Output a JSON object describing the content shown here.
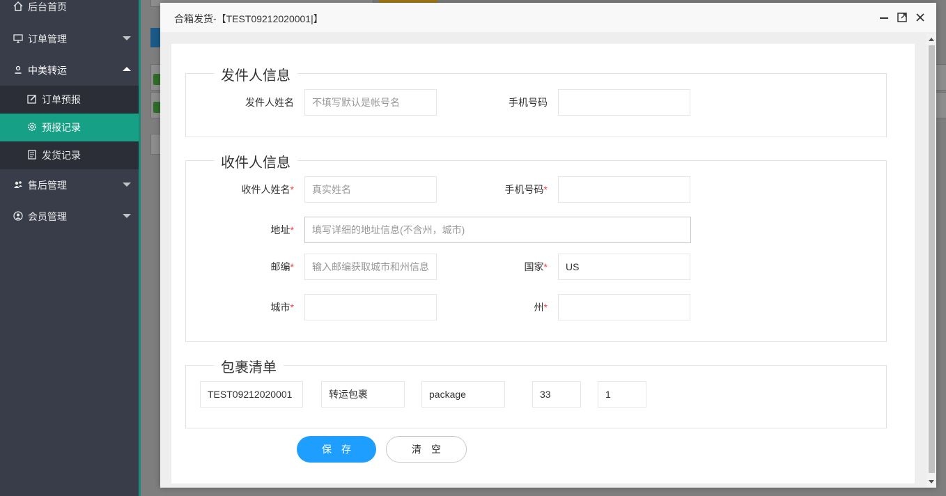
{
  "sidebar": {
    "items": [
      {
        "label": "后台首页",
        "icon": "home-icon"
      },
      {
        "label": "订单管理",
        "icon": "monitor-icon"
      },
      {
        "label": "中美转运",
        "icon": "user-icon"
      },
      {
        "label": "订单预报",
        "icon": "edit-icon"
      },
      {
        "label": "预报记录",
        "icon": "gear-icon"
      },
      {
        "label": "发货记录",
        "icon": "document-icon"
      },
      {
        "label": "售后管理",
        "icon": "group-icon"
      },
      {
        "label": "会员管理",
        "icon": "member-icon"
      }
    ],
    "active_color": "#16a086"
  },
  "modal": {
    "title": "合箱发货-【TEST09212020001|】",
    "sender": {
      "legend": "发件人信息",
      "name_label": "发件人姓名",
      "name_placeholder": "不填写默认是帐号名",
      "name_value": "",
      "phone_label": "手机号码",
      "phone_value": ""
    },
    "receiver": {
      "legend": "收件人信息",
      "name_label": "收件人姓名",
      "name_placeholder": "真实姓名",
      "phone_label": "手机号码",
      "address_label": "地址",
      "address_placeholder": "填写详细的地址信息(不含州，城市)",
      "zip_label": "邮编",
      "zip_placeholder": "输入邮编获取城市和州信息",
      "country_label": "国家",
      "country_value": "US",
      "city_label": "城市",
      "state_label": "州",
      "required_mark": "*"
    },
    "packages": {
      "legend": "包裹清单",
      "row": {
        "tracking": "TEST09212020001",
        "type": "转运包裹",
        "name": "package",
        "weight": "33",
        "qty": "1"
      }
    },
    "buttons": {
      "save": "保存",
      "clear": "清空"
    }
  },
  "colors": {
    "primary_button": "#1e9fff",
    "required": "#ff3b3b"
  }
}
